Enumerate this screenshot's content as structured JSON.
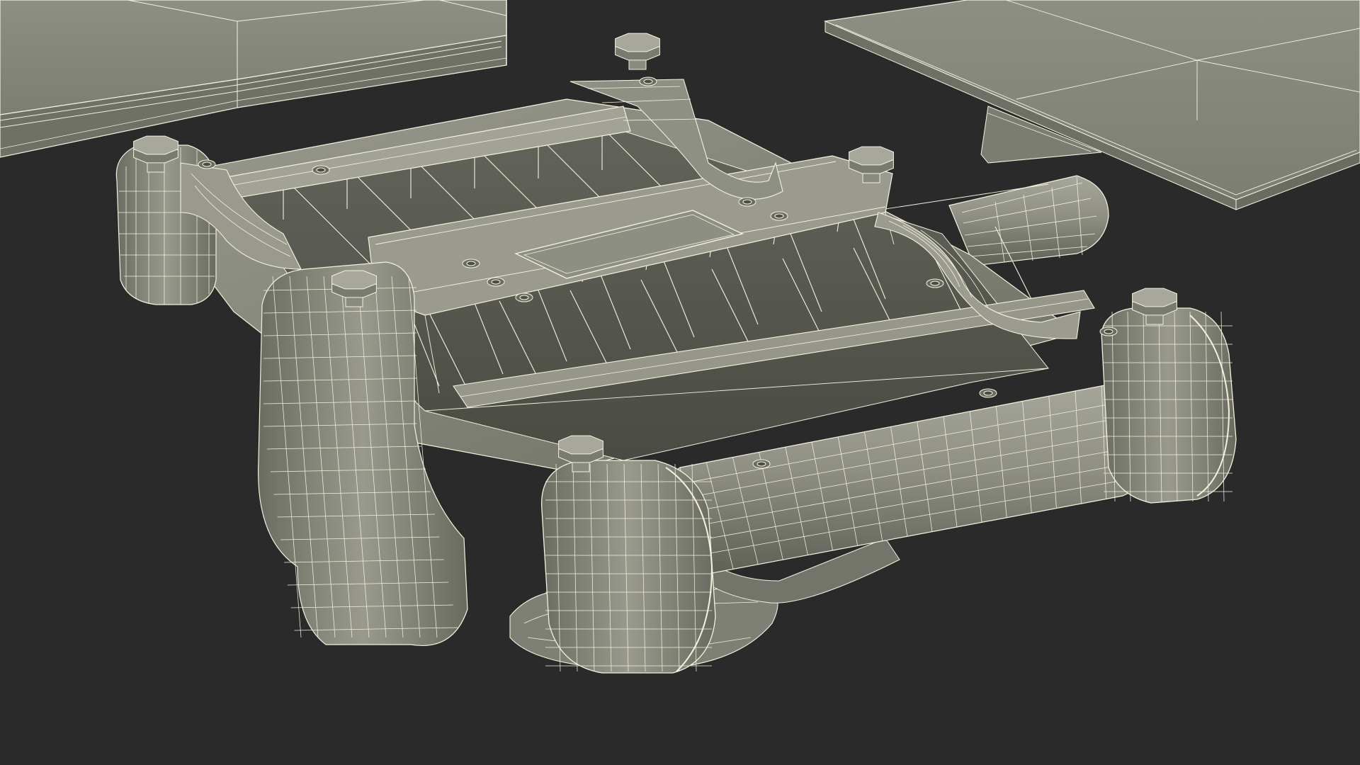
{
  "scene": {
    "subject_icon": "wireframe-mechanical-assembly-icon",
    "colors": {
      "background": "#2a2a2a",
      "surface": "#8d8e80",
      "surface_light": "#a3a497",
      "surface_dark": "#5e5f55",
      "cavity": "#505148",
      "wire": "#f4f2de",
      "wire_dim": "#cfcdb8"
    }
  }
}
